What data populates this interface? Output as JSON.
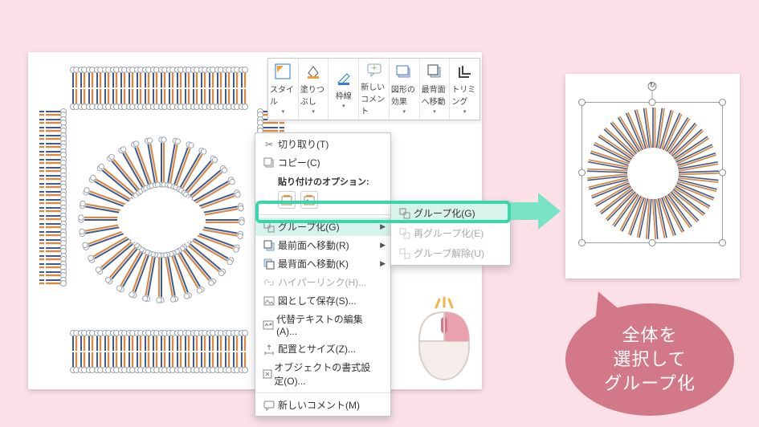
{
  "ribbon": {
    "style": "スタイル",
    "fill": "塗りつぶし",
    "outline": "枠線",
    "new_comment": "新しいコメント",
    "effects": "図形の効果",
    "send_back": "最背面へ移動",
    "trimming": "トリミング"
  },
  "context": {
    "cut": "切り取り(T)",
    "copy": "コピー(C)",
    "paste_header": "貼り付けのオプション:",
    "group": "グループ化(G)",
    "bring_front": "最前面へ移動(R)",
    "send_back": "最背面へ移動(K)",
    "hyperlink": "ハイパーリンク(H)...",
    "save_as_pic": "図として保存(S)...",
    "alt_text": "代替テキストの編集(A)...",
    "size_pos": "配置とサイズ(Z)...",
    "format_obj": "オブジェクトの書式設定(O)...",
    "new_comment": "新しいコメント(M)"
  },
  "submenu": {
    "group": "グループ化(G)",
    "regroup": "再グループ化(E)",
    "ungroup": "グループ解除(U)"
  },
  "callout": {
    "line1": "全体を",
    "line2": "選択して",
    "line3": "グループ化"
  },
  "colors": {
    "accent": "#38d6a9",
    "callout": "#d37889",
    "bg": "#fbe0e8",
    "blue": "#3b5c93",
    "orange": "#d98a44"
  }
}
